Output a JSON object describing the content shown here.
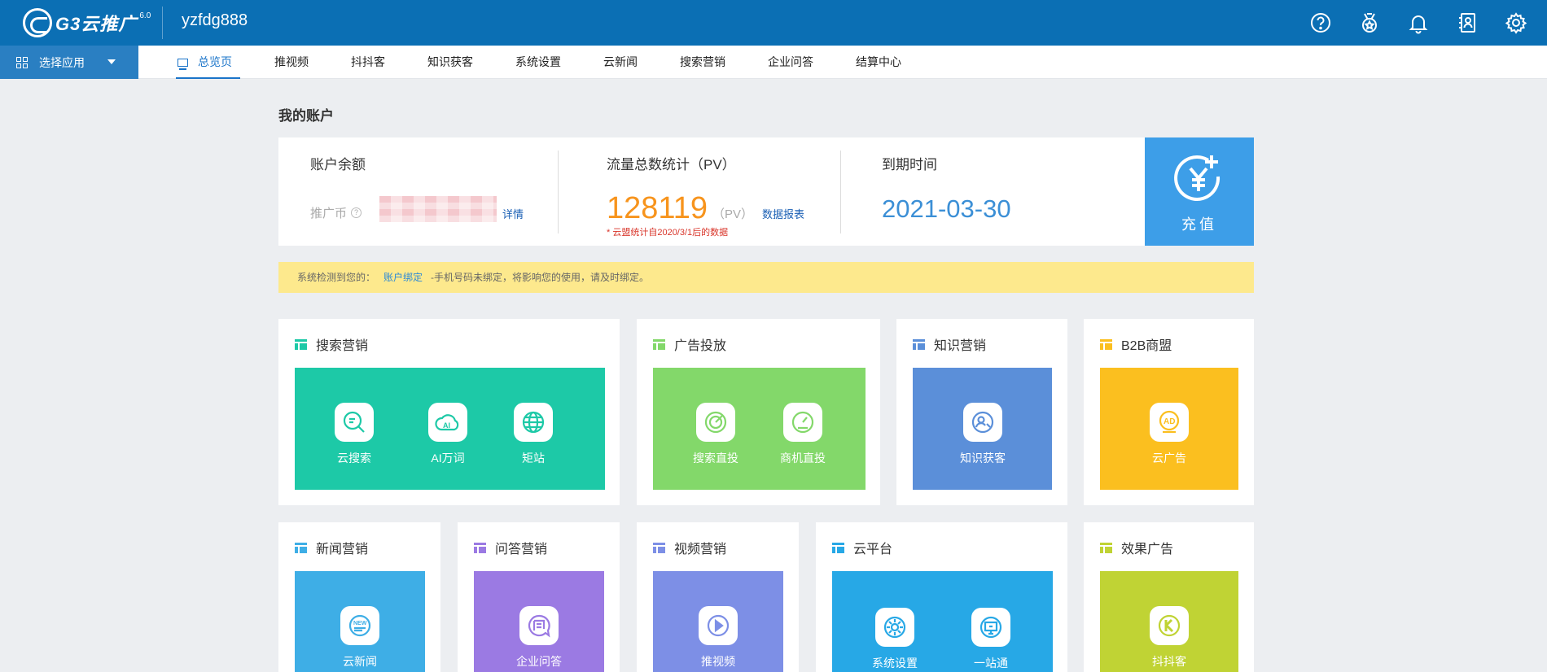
{
  "topbar": {
    "logo_text": "G3云推广",
    "logo_version": "6.0",
    "username": "yzfdg888",
    "icons": [
      "help-icon",
      "medal-icon",
      "bell-icon",
      "contacts-icon",
      "settings-icon"
    ]
  },
  "nav": {
    "app_select_label": "选择应用",
    "tabs": [
      {
        "label": "总览页",
        "active": true
      },
      {
        "label": "推视频"
      },
      {
        "label": "抖抖客"
      },
      {
        "label": "知识获客"
      },
      {
        "label": "系统设置"
      },
      {
        "label": "云新闻"
      },
      {
        "label": "搜索营销"
      },
      {
        "label": "企业问答"
      },
      {
        "label": "结算中心"
      }
    ]
  },
  "account": {
    "section_title": "我的账户",
    "balance_label": "账户余额",
    "coin_label": "推广币",
    "coin_help": "?",
    "detail_link": "详情",
    "pv_label": "流量总数统计（PV）",
    "pv_value": "128119",
    "pv_unit": "（PV）",
    "report_link": "数据报表",
    "pv_note": "* 云盟统计自2020/3/1后的数据",
    "expire_label": "到期时间",
    "expire_value": "2021-03-30",
    "recharge_label": "充值"
  },
  "notice": {
    "prefix": "系统检测到您的：",
    "link": "账户绑定",
    "text": "-手机号码未绑定，将影响您的使用，请及时绑定。"
  },
  "cards": {
    "search": {
      "title": "搜索营销",
      "color": "#1dc9a7",
      "items": [
        "云搜索",
        "AI万词",
        "矩站"
      ]
    },
    "ads": {
      "title": "广告投放",
      "color": "#83d86a",
      "items": [
        "搜索直投",
        "商机直投"
      ]
    },
    "knowledge": {
      "title": "知识营销",
      "color": "#5b8fd9",
      "items": [
        "知识获客"
      ]
    },
    "b2b": {
      "title": "B2B商盟",
      "color": "#fbbf1f",
      "items": [
        "云广告"
      ]
    },
    "news": {
      "title": "新闻营销",
      "color": "#3eaee6",
      "items": [
        "云新闻"
      ]
    },
    "qa": {
      "title": "问答营销",
      "color": "#9b7ae3",
      "items": [
        "企业问答"
      ]
    },
    "video": {
      "title": "视频营销",
      "color": "#7d8fe6",
      "items": [
        "推视频"
      ]
    },
    "cloud": {
      "title": "云平台",
      "color": "#27a8e6",
      "items": [
        "系统设置",
        "一站通"
      ]
    },
    "effect": {
      "title": "效果广告",
      "color": "#c0d334",
      "items": [
        "抖抖客"
      ]
    }
  }
}
